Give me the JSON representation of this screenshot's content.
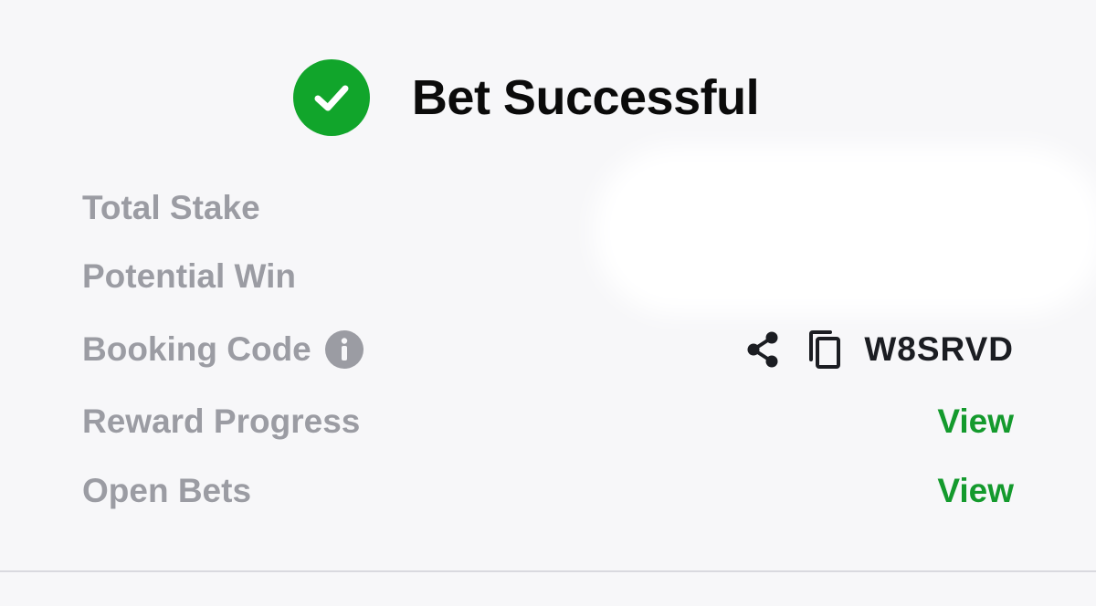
{
  "header": {
    "title": "Bet Successful",
    "status_icon": "check-circle-icon",
    "status_color": "#11a52b"
  },
  "rows": {
    "total_stake": {
      "label": "Total Stake",
      "value": ""
    },
    "potential_win": {
      "label": "Potential Win",
      "value": ""
    },
    "booking_code": {
      "label": "Booking Code",
      "info_icon": "info-icon",
      "share_icon": "share-icon",
      "copy_icon": "copy-icon",
      "code": "W8SRVD"
    },
    "reward_progress": {
      "label": "Reward Progress",
      "link": "View"
    },
    "open_bets": {
      "label": "Open Bets",
      "link": "View"
    }
  },
  "colors": {
    "accent": "#149a2d",
    "label": "#9b9ca3",
    "text": "#0b0b0b",
    "background": "#f7f7f9"
  }
}
